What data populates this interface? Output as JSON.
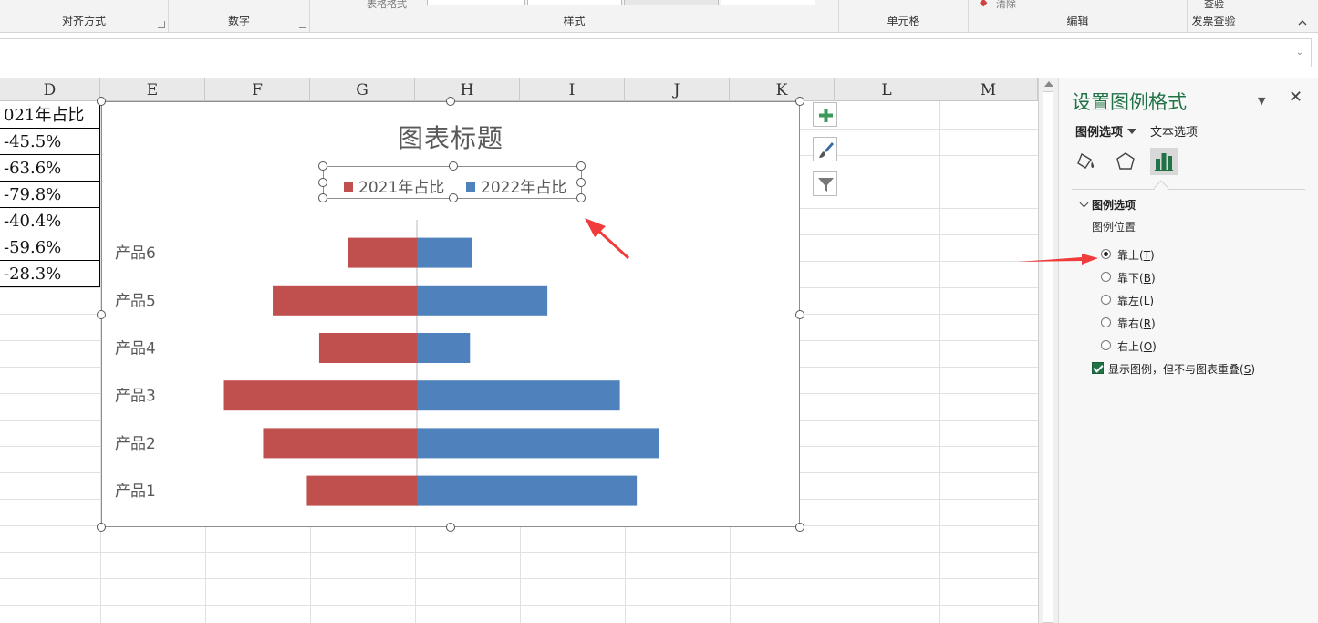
{
  "ribbon": {
    "groups": [
      {
        "label": "对齐方式"
      },
      {
        "label": "数字"
      },
      {
        "label": "样式"
      },
      {
        "label": "单元格"
      },
      {
        "label": "编辑"
      },
      {
        "label": "发票查验"
      }
    ],
    "table_format_partial": "表格格式",
    "clear_partial": "清除",
    "check_partial": "查验"
  },
  "sheet": {
    "columns": [
      "D",
      "E",
      "F",
      "G",
      "H",
      "I",
      "J",
      "K",
      "L",
      "M"
    ],
    "d_cells": [
      "021年占比",
      "-45.5%",
      "-63.6%",
      "-79.8%",
      "-40.4%",
      "-59.6%",
      "-28.3%"
    ]
  },
  "chart": {
    "title": "图表标题",
    "legend": [
      "2021年占比",
      "2022年占比"
    ],
    "colors": {
      "s2021": "#c0504d",
      "s2022": "#4f81bd"
    }
  },
  "chart_data": {
    "type": "bar",
    "orientation": "horizontal",
    "title": "图表标题",
    "categories": [
      "产品6",
      "产品5",
      "产品4",
      "产品3",
      "产品2",
      "产品1"
    ],
    "series": [
      {
        "name": "2021年占比",
        "values": [
          -28.3,
          -59.6,
          -40.4,
          -79.8,
          -63.6,
          -45.5
        ]
      },
      {
        "name": "2022年占比",
        "values": [
          23,
          54,
          22,
          84,
          100,
          91
        ]
      }
    ],
    "xlim": [
      -100,
      100
    ],
    "legend_position": "top",
    "grid": false
  },
  "side_buttons": [
    "chart-elements-plus-icon",
    "chart-styles-brush-icon",
    "chart-filter-icon"
  ],
  "pane": {
    "title": "设置图例格式",
    "tabs": {
      "legend_options": "图例选项",
      "text_options": "文本选项"
    },
    "section_title": "图例选项",
    "position_label": "图例位置",
    "options": [
      {
        "label": "靠上",
        "key": "T",
        "selected": true
      },
      {
        "label": "靠下",
        "key": "B",
        "selected": false
      },
      {
        "label": "靠左",
        "key": "L",
        "selected": false
      },
      {
        "label": "靠右",
        "key": "R",
        "selected": false
      },
      {
        "label": "右上",
        "key": "O",
        "selected": false
      }
    ],
    "overlap_checkbox": {
      "label": "显示图例，但不与图表重叠",
      "key": "S",
      "checked": true
    }
  },
  "annotation_color": "#f03c3c"
}
